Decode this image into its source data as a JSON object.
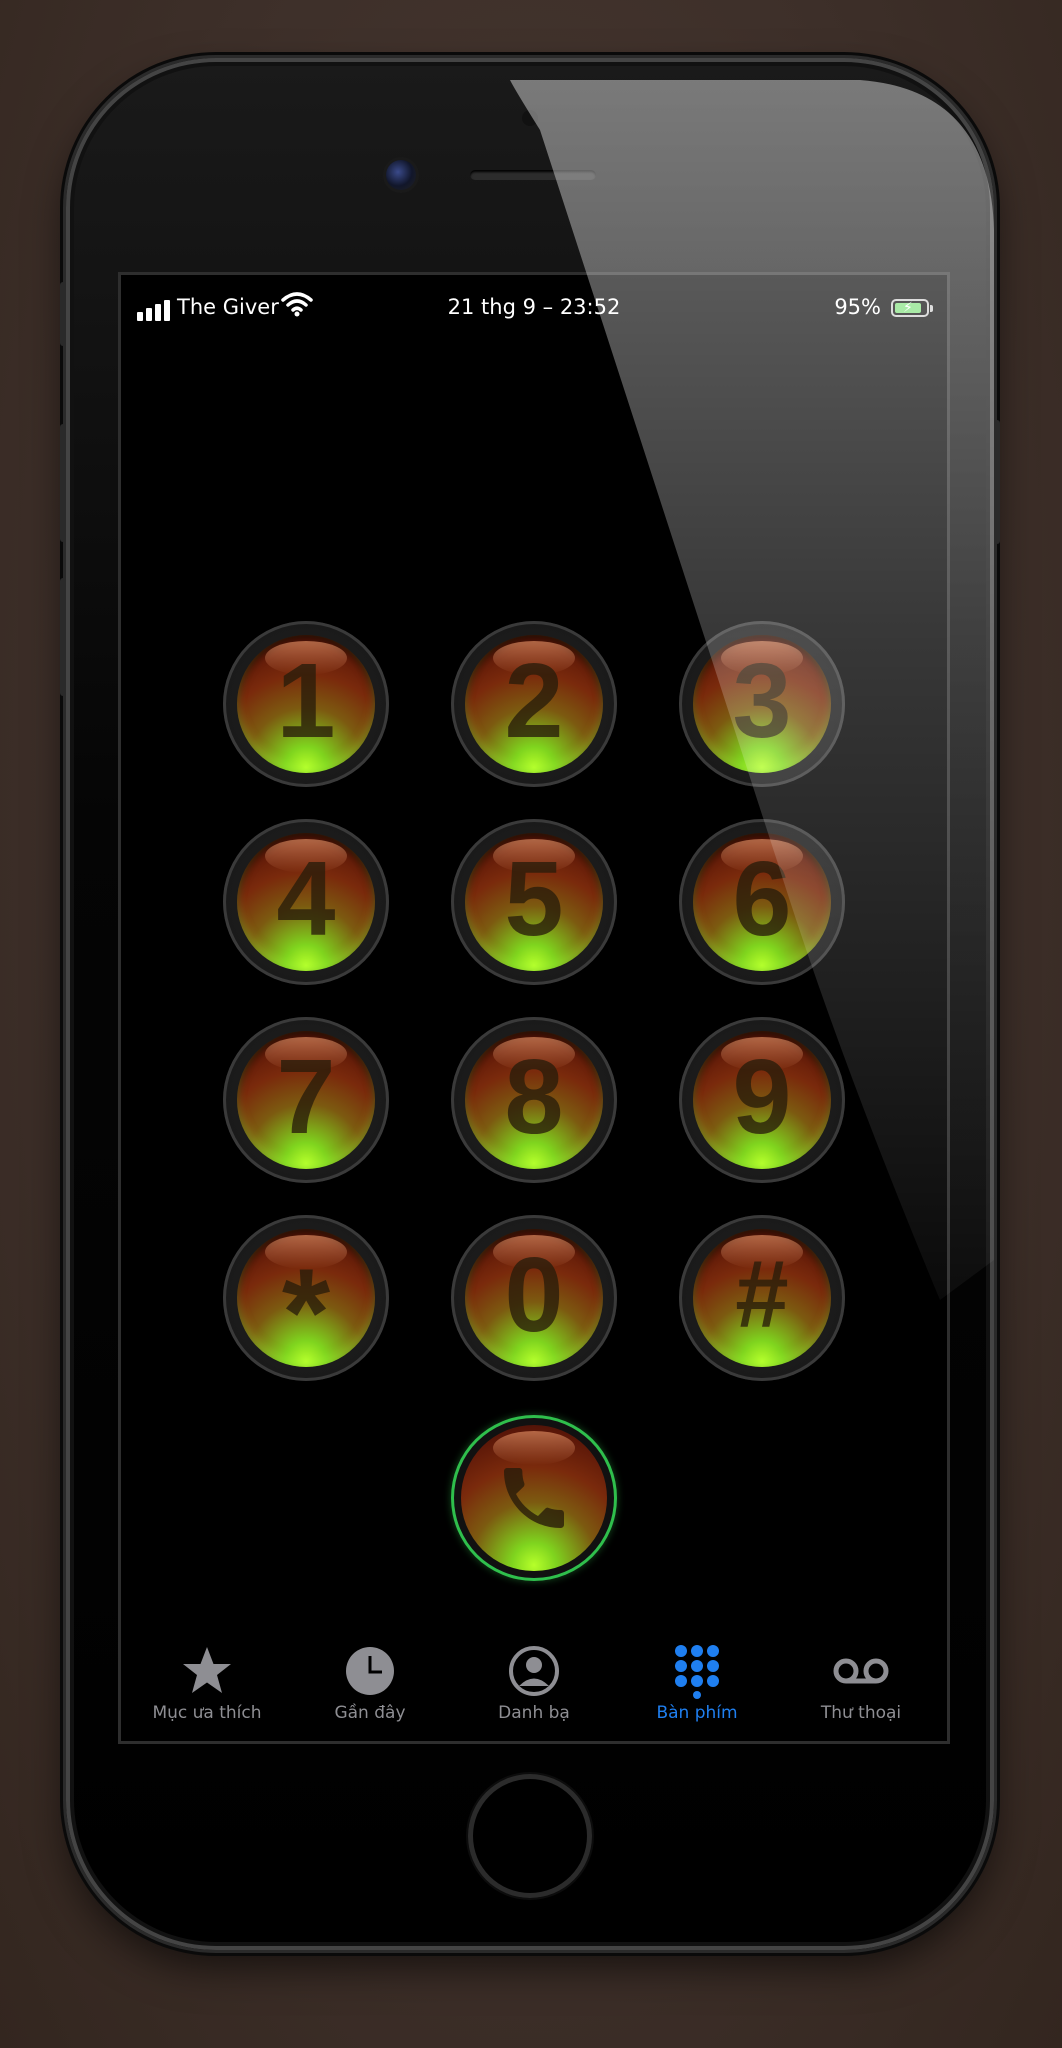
{
  "status_bar": {
    "carrier": "The Giver",
    "datetime": "21 thg 9 – 23:52",
    "battery_percent": "95%",
    "battery_level": 0.95,
    "battery_charging": true
  },
  "keypad": {
    "keys": [
      {
        "label": "1"
      },
      {
        "label": "2"
      },
      {
        "label": "3"
      },
      {
        "label": "4"
      },
      {
        "label": "5"
      },
      {
        "label": "6"
      },
      {
        "label": "7"
      },
      {
        "label": "8"
      },
      {
        "label": "9"
      },
      {
        "label": "*"
      },
      {
        "label": "0"
      },
      {
        "label": "#"
      }
    ],
    "call_icon": "phone-icon"
  },
  "tab_bar": {
    "tabs": [
      {
        "label": "Mục ưa thích",
        "icon": "star-icon",
        "active": false
      },
      {
        "label": "Gần đây",
        "icon": "clock-icon",
        "active": false
      },
      {
        "label": "Danh bạ",
        "icon": "contact-icon",
        "active": false
      },
      {
        "label": "Bàn phím",
        "icon": "keypad-icon",
        "active": true
      },
      {
        "label": "Thư thoại",
        "icon": "voicemail-icon",
        "active": false
      }
    ],
    "active_color": "#1f7ff0",
    "inactive_color": "#8e8e93"
  },
  "colors": {
    "background": "#3d2f29",
    "call_ring": "#2fbf4c"
  }
}
